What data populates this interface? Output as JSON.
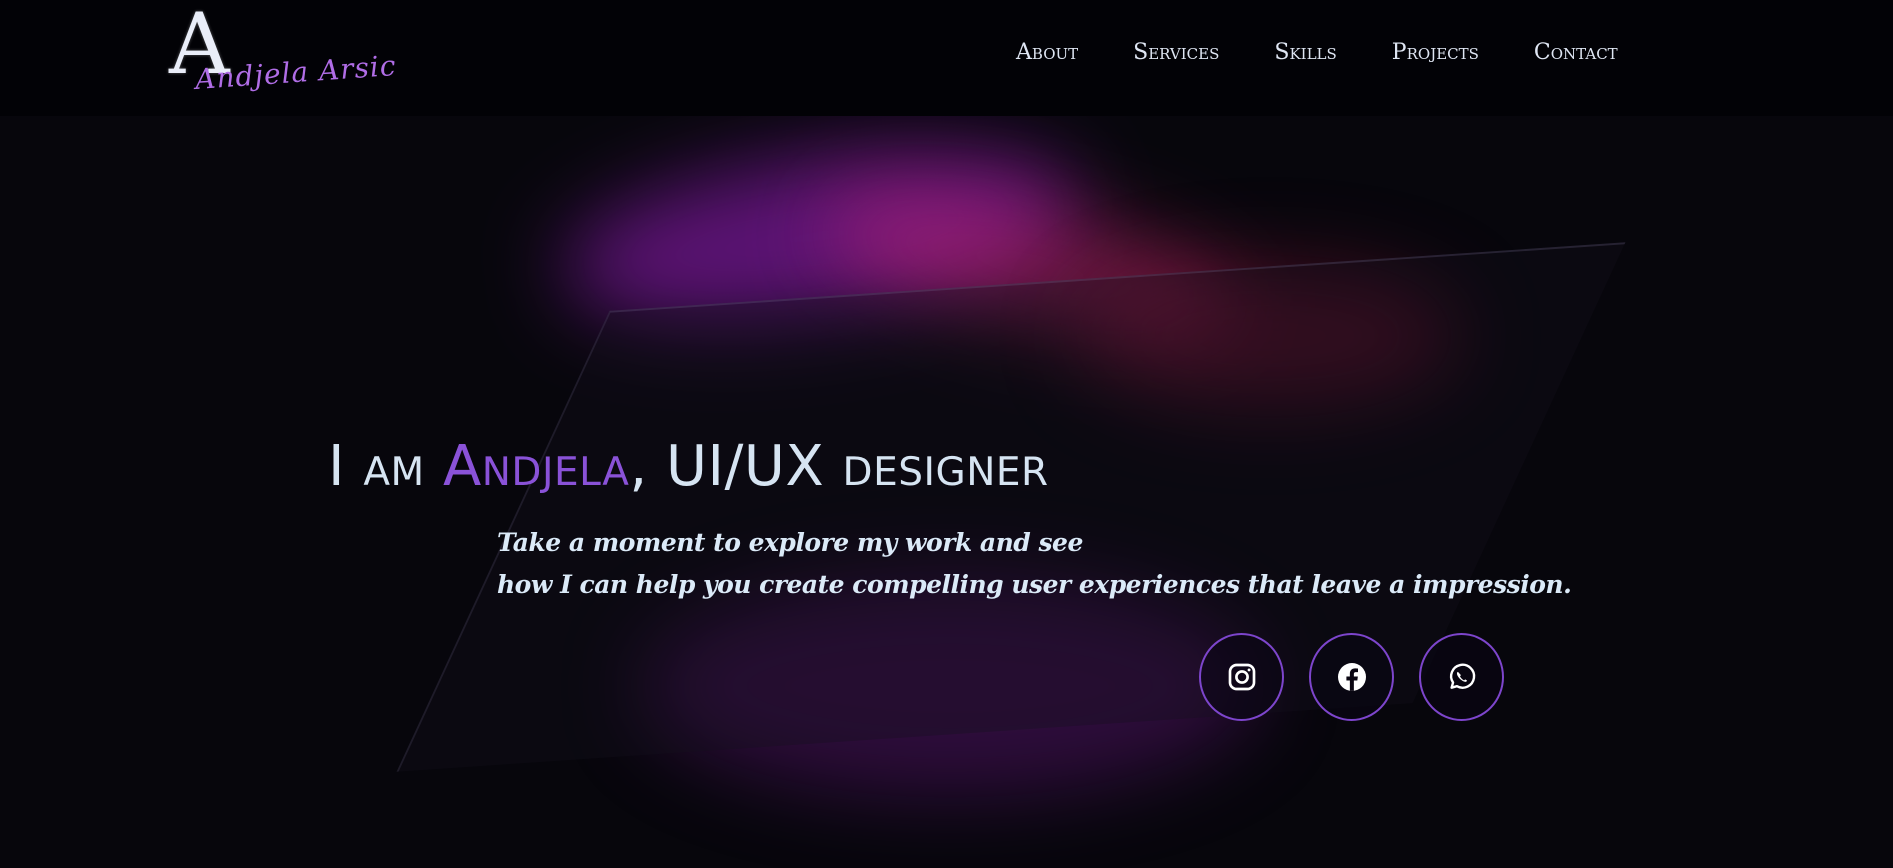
{
  "logo": {
    "letter": "A",
    "script": "Andjela Arsic"
  },
  "nav": {
    "items": [
      {
        "label": "About"
      },
      {
        "label": "Services"
      },
      {
        "label": "Skills"
      },
      {
        "label": "Projects"
      },
      {
        "label": "Contact"
      }
    ]
  },
  "hero": {
    "headline_prefix": "I am ",
    "headline_name": "Andjela",
    "headline_suffix": ", UI/UX designer",
    "tagline_line1": "Take a moment to explore my work and see",
    "tagline_line2": "how I can help you create compelling user experiences that leave a impression."
  },
  "socials": [
    {
      "icon": "instagram-icon"
    },
    {
      "icon": "facebook-icon"
    },
    {
      "icon": "whatsapp-icon"
    }
  ],
  "colors": {
    "accent": "#8a52d8",
    "ring": "#7d45cc",
    "text": "#d6e4f2",
    "background": "#05040a"
  }
}
